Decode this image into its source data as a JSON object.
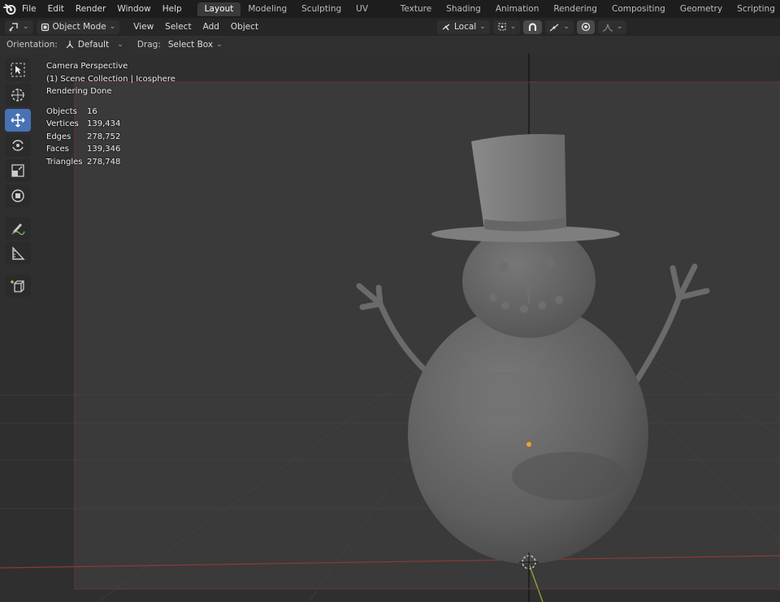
{
  "menu": [
    "File",
    "Edit",
    "Render",
    "Window",
    "Help"
  ],
  "workspaces": [
    "Layout",
    "Modeling",
    "Sculpting",
    "UV Editing",
    "Texture Paint",
    "Shading",
    "Animation",
    "Rendering",
    "Compositing",
    "Geometry Nodes",
    "Scripting"
  ],
  "add_workspace": "+",
  "header": {
    "mode": "Object Mode",
    "menus": [
      "View",
      "Select",
      "Add",
      "Object"
    ],
    "pivot": "Local"
  },
  "tool_settings": {
    "orientation_label": "Orientation:",
    "orientation_value": "Default",
    "drag_label": "Drag:",
    "drag_value": "Select Box"
  },
  "overlay": {
    "view_name": "Camera Perspective",
    "collection": "(1) Scene Collection | Icosphere",
    "status": "Rendering Done",
    "stats": [
      {
        "label": "Objects",
        "value": "16"
      },
      {
        "label": "Vertices",
        "value": "139,434"
      },
      {
        "label": "Edges",
        "value": "278,752"
      },
      {
        "label": "Faces",
        "value": "139,346"
      },
      {
        "label": "Triangles",
        "value": "278,748"
      }
    ]
  },
  "tools": [
    "select-box-icon",
    "cursor-icon",
    "move-icon",
    "rotate-icon",
    "scale-icon",
    "transform-icon",
    "annotate-icon",
    "measure-icon",
    "add-cube-icon"
  ],
  "colors": {
    "accent": "#4772b3",
    "origin": "#f0a030",
    "camera_frame": "#8a3a3a"
  }
}
